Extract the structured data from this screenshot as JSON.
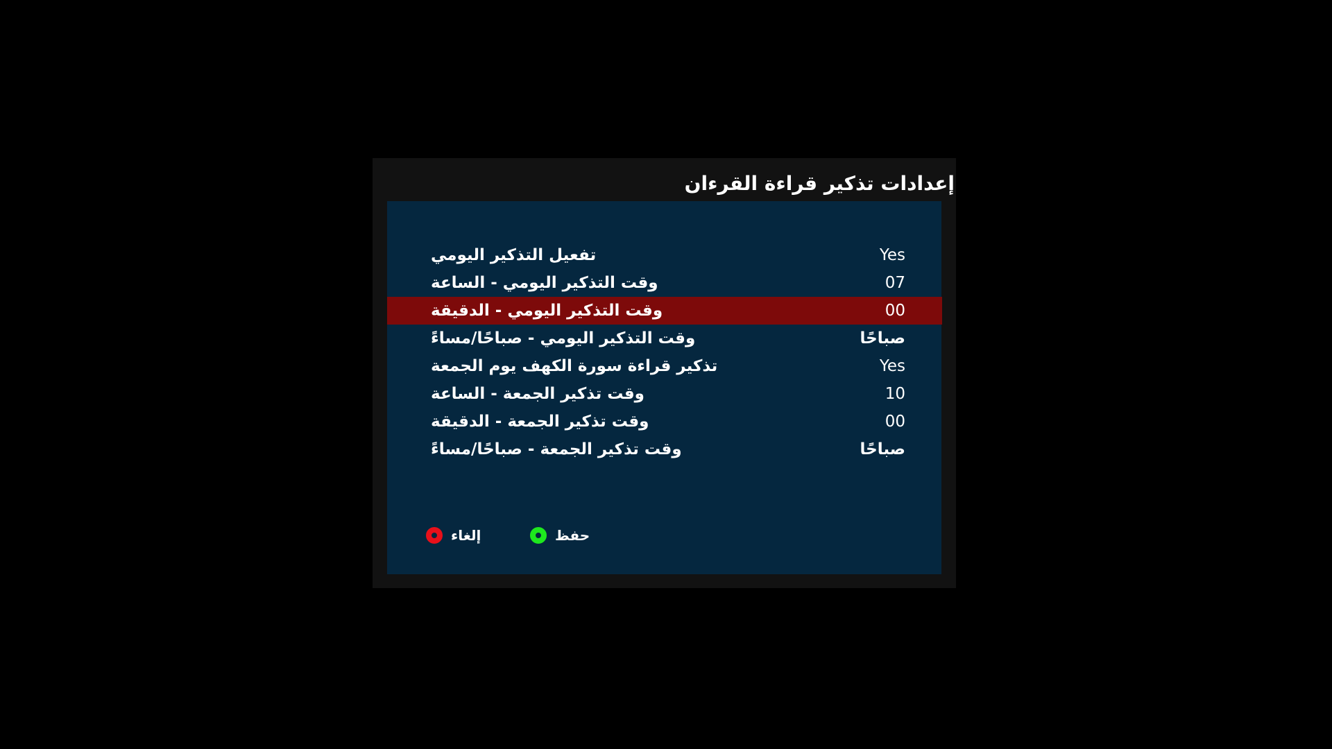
{
  "dialog": {
    "title": "إعدادات تذكير قراءة القرءان"
  },
  "settings": [
    {
      "label": "تفعيل التذكير اليومي",
      "value": "Yes",
      "selected": false
    },
    {
      "label": "وقت التذكير اليومي - الساعة",
      "value": "07",
      "selected": false
    },
    {
      "label": "وقت التذكير اليومي - الدقيقة",
      "value": "00",
      "selected": true
    },
    {
      "label": "وقت التذكير اليومي - صباحًا/مساءً",
      "value": "صباحًا",
      "selected": false
    },
    {
      "label": "تذكير قراءة سورة الكهف يوم الجمعة",
      "value": "Yes",
      "selected": false
    },
    {
      "label": "وقت تذكير الجمعة - الساعة",
      "value": "10",
      "selected": false
    },
    {
      "label": "وقت تذكير الجمعة - الدقيقة",
      "value": "00",
      "selected": false
    },
    {
      "label": "وقت تذكير الجمعة - صباحًا/مساءً",
      "value": "صباحًا",
      "selected": false
    }
  ],
  "footer": {
    "cancel_label": "إلغاء",
    "save_label": "حفظ"
  },
  "colors": {
    "background": "#000000",
    "dialog": "#121212",
    "panel": "#05273f",
    "selected_row": "#7d0a0a",
    "cancel_ring": "#e8101a",
    "save_ring": "#1ee81e"
  },
  "icons": {
    "cancel": "red-ring-icon",
    "save": "green-ring-icon"
  }
}
